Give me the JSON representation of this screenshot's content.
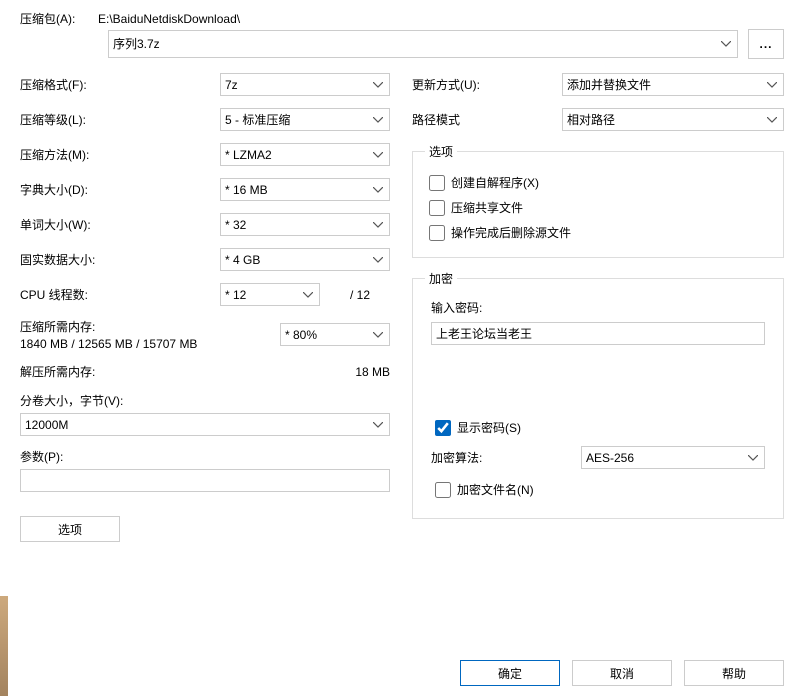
{
  "archive": {
    "label": "压缩包(A):",
    "path": "E:\\BaiduNetdiskDownload\\",
    "filename": "序列3.7z",
    "browse": "..."
  },
  "left": {
    "format_label": "压缩格式(F):",
    "format_value": "7z",
    "level_label": "压缩等级(L):",
    "level_value": "5 - 标准压缩",
    "method_label": "压缩方法(M):",
    "method_value": "* LZMA2",
    "dict_label": "字典大小(D):",
    "dict_value": "* 16 MB",
    "word_label": "单词大小(W):",
    "word_value": "* 32",
    "solid_label": "固实数据大小:",
    "solid_value": "* 4 GB",
    "threads_label": "CPU 线程数:",
    "threads_value": "* 12",
    "threads_suffix": "/ 12",
    "mem_comp_label": "压缩所需内存:",
    "mem_comp_value": "1840 MB / 12565 MB / 15707 MB",
    "mem_pct_value": "* 80%",
    "mem_decomp_label": "解压所需内存:",
    "mem_decomp_value": "18 MB",
    "volume_label": "分卷大小，字节(V):",
    "volume_value": "12000M",
    "params_label": "参数(P):",
    "params_value": "",
    "options_button": "选项"
  },
  "right": {
    "update_label": "更新方式(U):",
    "update_value": "添加并替换文件",
    "pathmode_label": "路径模式",
    "pathmode_value": "相对路径",
    "options_legend": "选项",
    "opt_sfx": "创建自解程序(X)",
    "opt_shared": "压缩共享文件",
    "opt_delete": "操作完成后删除源文件",
    "enc_legend": "加密",
    "enc_pw_label": "输入密码:",
    "enc_pw_value": "上老王论坛当老王",
    "enc_show": "显示密码(S)",
    "enc_method_label": "加密算法:",
    "enc_method_value": "AES-256",
    "enc_names": "加密文件名(N)"
  },
  "buttons": {
    "ok": "确定",
    "cancel": "取消",
    "help": "帮助"
  }
}
